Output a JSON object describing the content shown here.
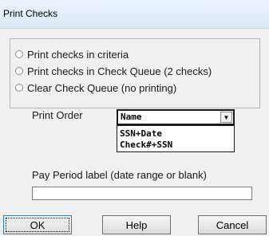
{
  "window": {
    "title": "Print Checks"
  },
  "options": {
    "items": [
      "Print checks in criteria",
      "Print checks in Check Queue (2 checks)",
      "Clear Check Queue (no printing)"
    ]
  },
  "print_order": {
    "label": "Print Order",
    "selected": "Name",
    "dropdown_icon": "chevron-down-icon",
    "options": [
      "SSN+Date",
      "Check#+SSN"
    ]
  },
  "pay_period": {
    "label": "Pay Period label (date range or blank)",
    "value": ""
  },
  "buttons": {
    "ok": "OK",
    "help": "Help",
    "cancel": "Cancel"
  }
}
